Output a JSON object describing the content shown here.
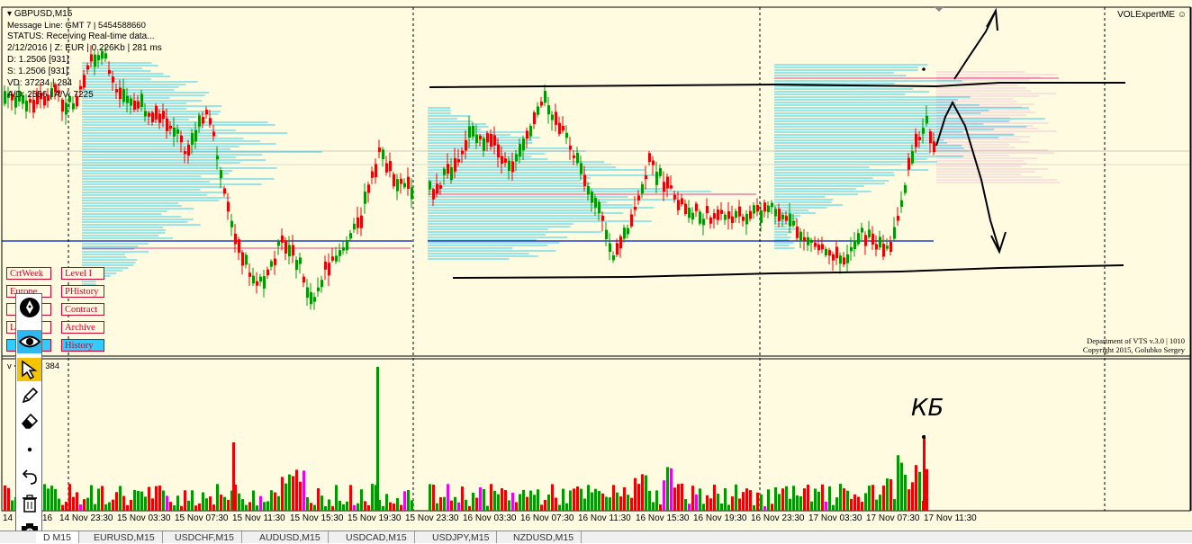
{
  "chart": {
    "symbol_label": "GBPUSD,M15",
    "info_lines": [
      "Message Line: GMT 7 | 5454588660",
      "STATUS:  Receiving Real-time data...",
      "2/12/2016 | Z: EUR | 0.226Kb | 281 ms",
      "D: 1.2506  [931]",
      "S: 1.2506  [931]",
      "VD: 37234 | 284",
      "A/D: 2556 | A/V: 7225"
    ],
    "ea_name": "VOLExpertME",
    "copyright_line1": "Department of VTS  v.3.0 | 1010",
    "copyright_line2": "Copyright 2015, Golubko Sergey",
    "volume_label": "<CME> 384",
    "handwriting": "КБ"
  },
  "side_buttons": [
    {
      "label": "CrtWeek",
      "style": "outline"
    },
    {
      "label": "Level I",
      "style": "outline"
    },
    {
      "label": "Europe",
      "style": "outline"
    },
    {
      "label": "PHistory",
      "style": "outline"
    },
    {
      "label": "",
      "style": "outline"
    },
    {
      "label": "Contract",
      "style": "outline"
    },
    {
      "label": "Levels",
      "style": "outline"
    },
    {
      "label": "Archive",
      "style": "outline"
    },
    {
      "label": "",
      "style": "cyan"
    },
    {
      "label": "History",
      "style": "cyan"
    }
  ],
  "time_axis": [
    "14",
    "16",
    "14 Nov 23:30",
    "15 Nov 03:30",
    "15 Nov 07:30",
    "15 Nov 11:30",
    "15 Nov 15:30",
    "15 Nov 19:30",
    "15 Nov 23:30",
    "16 Nov 03:30",
    "16 Nov 07:30",
    "16 Nov 11:30",
    "16 Nov 15:30",
    "16 Nov 19:30",
    "16 Nov 23:30",
    "17 Nov 03:30",
    "17 Nov 07:30",
    "17 Nov 11:30"
  ],
  "tabs": [
    "D M15",
    "EURUSD,M15",
    "USDCHF,M15",
    "AUDUSD,M15",
    "USDCAD,M15",
    "USDJPY,M15",
    "NZDUSD,M15"
  ],
  "tools": [
    "pen-icon",
    "eye-icon",
    "cursor-icon",
    "pencil-icon",
    "eraser-icon",
    "dot-icon",
    "undo-icon",
    "trash-icon",
    "camera-icon"
  ],
  "colors": {
    "background": "#fffbe0",
    "bull": "#009900",
    "bear": "#ee0000",
    "profile": "#33ccee",
    "level_blue": "#2040d0",
    "poc_red": "#e0408a",
    "marker": "#ee00ee",
    "toolbar_selected": "#f5c400",
    "toolbar_cyan": "#2fb8f0"
  }
}
